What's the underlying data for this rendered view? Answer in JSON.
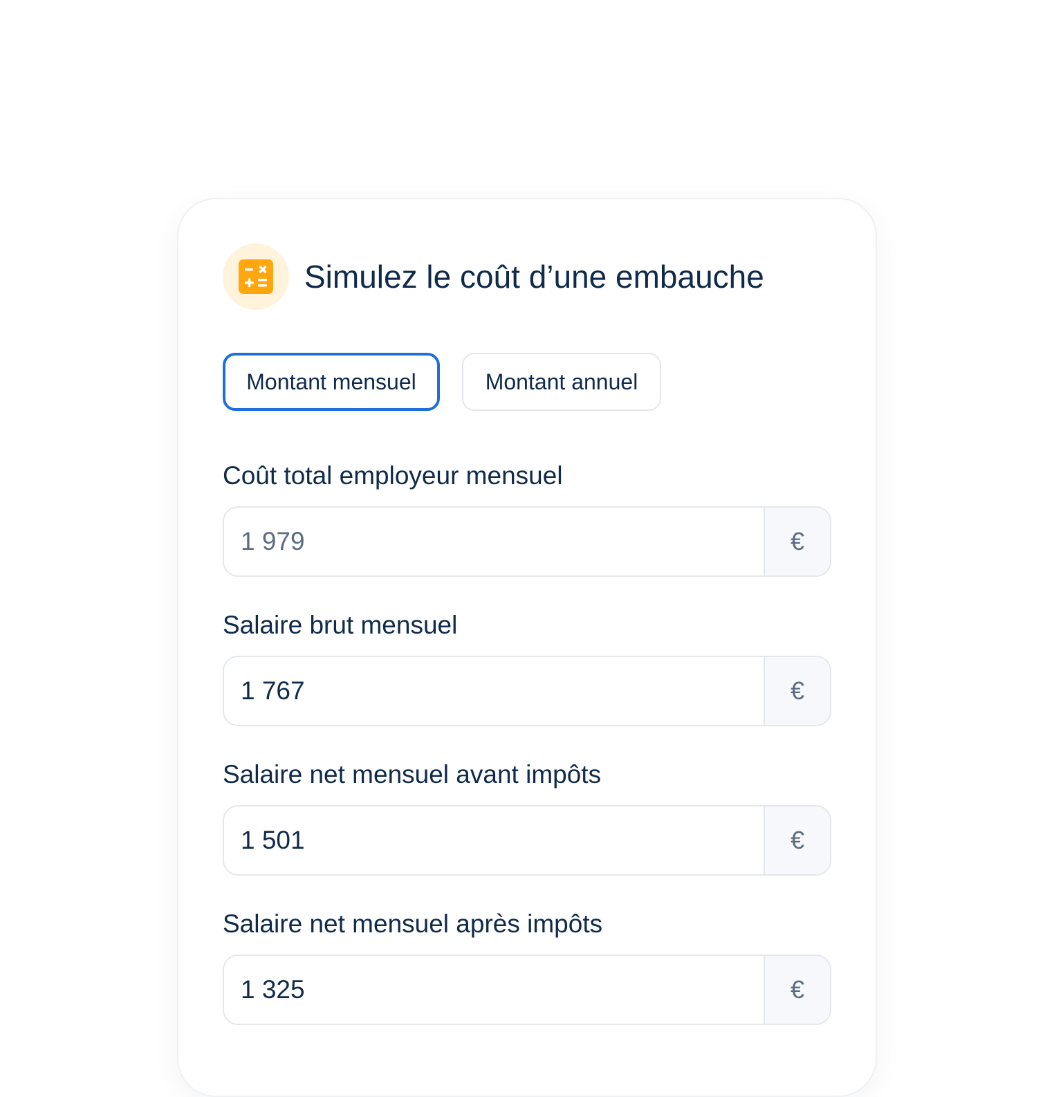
{
  "header": {
    "title": "Simulez le coût d’une embauche",
    "icon": "calculator-icon",
    "accent_color": "#ffa70d"
  },
  "toggles": {
    "monthly_label": "Montant mensuel",
    "annual_label": "Montant annuel",
    "selected": "monthly",
    "active_color": "#1f6fdb"
  },
  "fields": [
    {
      "label": "Coût total employeur mensuel",
      "value": "1 979",
      "unit": "€"
    },
    {
      "label": "Salaire brut mensuel",
      "value": "1 767",
      "unit": "€"
    },
    {
      "label": "Salaire net mensuel avant impôts",
      "value": "1 501",
      "unit": "€"
    },
    {
      "label": "Salaire net mensuel après impôts",
      "value": "1 325",
      "unit": "€"
    }
  ]
}
